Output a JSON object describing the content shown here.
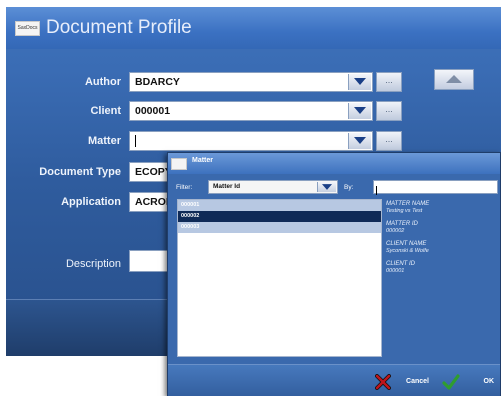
{
  "main": {
    "logo_text": "SaxDocs",
    "title": "Document Profile",
    "fields": {
      "author": {
        "label": "Author",
        "value": "BDARCY",
        "browse": "..."
      },
      "client": {
        "label": "Client",
        "value": "000001",
        "browse": "..."
      },
      "matter": {
        "label": "Matter",
        "value": "",
        "browse": "..."
      },
      "document_type": {
        "label": "Document Type",
        "value": "ECOPY"
      },
      "application": {
        "label": "Application",
        "value": "ACROB"
      },
      "description": {
        "label": "Description",
        "value": ""
      }
    }
  },
  "dialog": {
    "title": "Matter",
    "filter_label": "Filter:",
    "filter_value": "Matter Id",
    "by_label": "By:",
    "by_value": "",
    "rows": [
      {
        "id": "000001"
      },
      {
        "id": "000002"
      },
      {
        "id": "000003"
      }
    ],
    "selected_index": 1,
    "details": {
      "matter_name_label": "MATTER NAME",
      "matter_name": "Testing vs Test",
      "matter_id_label": "MATTER ID",
      "matter_id": "000002",
      "client_name_label": "CLIENT NAME",
      "client_name": "Syconski & Wolfe",
      "client_id_label": "CLIENT ID",
      "client_id": "000001"
    },
    "cancel_label": "Cancel",
    "ok_label": "OK"
  },
  "colors": {
    "main_bg": "#3a6cb4",
    "selection": "#0f2a57",
    "row_bg": "#b7c8e2",
    "cancel_icon": "#c0141c",
    "ok_icon": "#2f9d2f"
  },
  "icons": {
    "dropdown": "chevron-down-icon",
    "scroll_up": "triangle-up-icon",
    "cancel": "x-icon",
    "ok": "checkmark-icon"
  }
}
